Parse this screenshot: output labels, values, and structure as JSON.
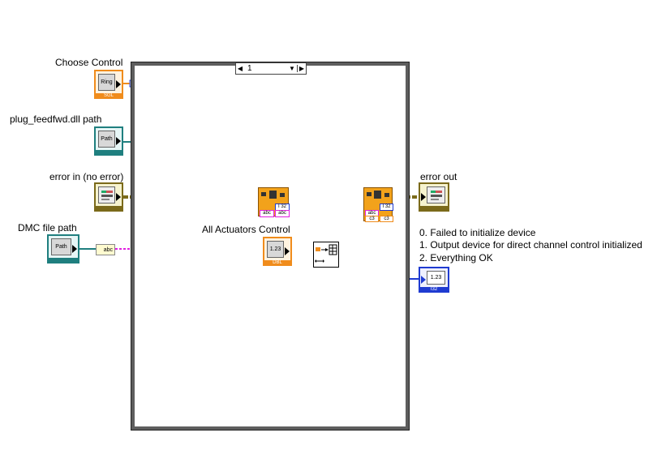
{
  "labels": {
    "choose_control": "Choose Control",
    "dll_path": "plug_feedfwd.dll path",
    "error_in": "error in (no error)",
    "dmc_path": "DMC file path",
    "actuators": "All Actuators Control",
    "error_out": "error out"
  },
  "case_selector": {
    "value": "1"
  },
  "terminals": {
    "ring": "Ring",
    "ring_type": "SGL",
    "path": "Path",
    "dbl_value": "1.23",
    "dbl_type": "DBL",
    "i32_value": "1.23",
    "i32_type": "I32"
  },
  "nodes": {
    "i32_a": "I 32",
    "abc_a1": "abc",
    "abc_a2": "abc",
    "i32_b": "I 32",
    "abc_b": "abc",
    "c3_b": "c3",
    "c3_b2": "c3",
    "abc_conv": "abc"
  },
  "description": {
    "line1": "0. Failed to initialize device",
    "line2": "1.  Output device for direct channel control initialized",
    "line3": "2. Everything OK"
  },
  "colors": {
    "orange": "#f08c1c",
    "teal": "#1f7f7f",
    "error": "#7b6a1a",
    "pink": "#e020e0",
    "blue": "#1f3bd1"
  }
}
